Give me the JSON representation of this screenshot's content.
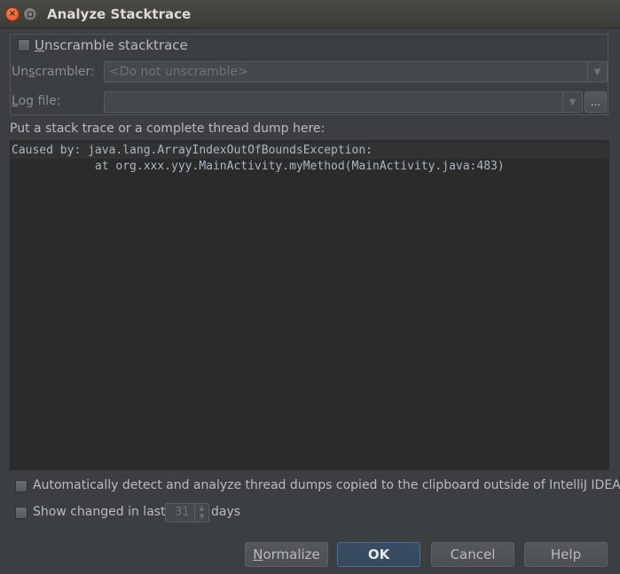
{
  "window": {
    "title": "Analyze Stacktrace",
    "close_glyph": "×",
    "close_icon": "close-icon",
    "minimize_icon": "minimize-icon"
  },
  "unscramble": {
    "checkbox_label_accel": "U",
    "checkbox_label_rest": "nscramble stacktrace",
    "checked": false,
    "unscrambler_label_pre": "Un",
    "unscrambler_label_accel": "s",
    "unscrambler_label_post": "crambler:",
    "unscrambler_value": "<Do not unscramble>",
    "logfile_label_accel": "L",
    "logfile_label_rest": "og file:",
    "logfile_value": "",
    "browse_label": "...",
    "dropdown_glyph": "▼"
  },
  "stacktrace": {
    "prompt": "Put a stack trace or a complete thread dump here:",
    "lines": [
      "Caused by: java.lang.ArrayIndexOutOfBoundsException:",
      "            at org.xxx.yyy.MainActivity.myMethod(MainActivity.java:483)"
    ]
  },
  "options": {
    "auto_detect_label": "Automatically detect and analyze thread dumps copied to the clipboard outside of IntelliJ IDEA",
    "auto_detect_checked": false,
    "show_changed_label": "Show changed in last",
    "show_changed_checked": false,
    "days_value": "31",
    "days_label": "days",
    "spinner_up": "▲",
    "spinner_down": "▼"
  },
  "buttons": {
    "normalize_accel": "N",
    "normalize_rest": "ormalize",
    "ok": "OK",
    "cancel": "Cancel",
    "help": "Help"
  },
  "colors": {
    "background": "#3c3f41",
    "editor_background": "#2b2b2b",
    "default_button_border": "#4a6f96",
    "close_button": "#df4a16"
  }
}
